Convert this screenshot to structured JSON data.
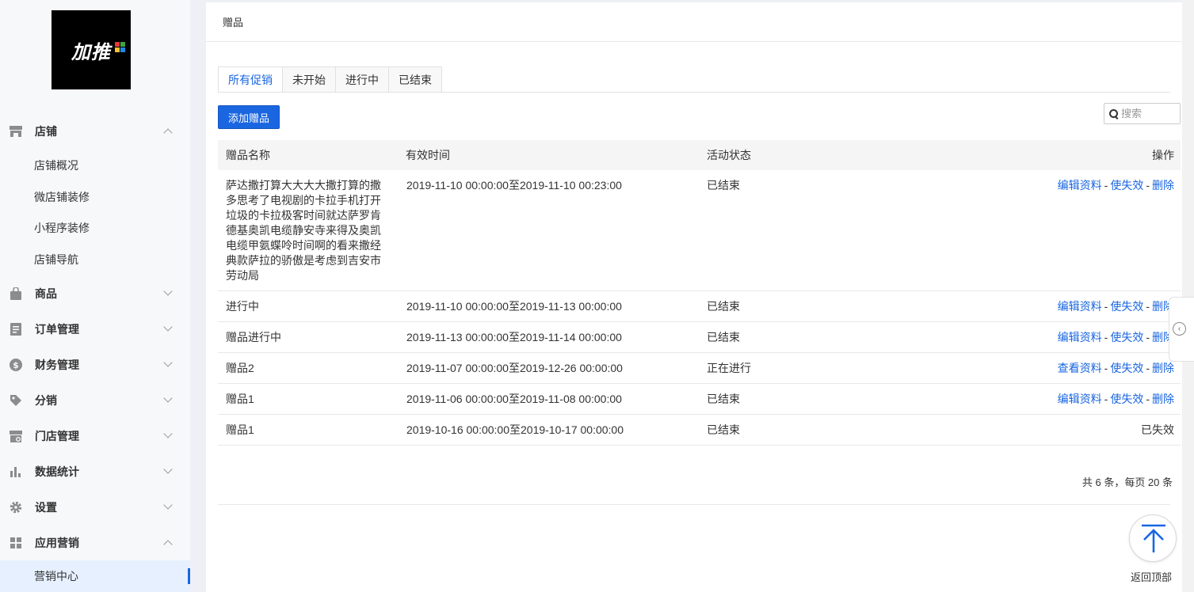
{
  "logo": {
    "text": "加推"
  },
  "sidebar": {
    "groups": [
      {
        "label": "店铺",
        "icon": "store-icon",
        "expanded": true
      },
      {
        "label": "商品",
        "icon": "bag-icon",
        "expanded": false
      },
      {
        "label": "订单管理",
        "icon": "document-icon",
        "expanded": false
      },
      {
        "label": "财务管理",
        "icon": "money-icon",
        "expanded": false
      },
      {
        "label": "分销",
        "icon": "tag-icon",
        "expanded": false
      },
      {
        "label": "门店管理",
        "icon": "shop-icon",
        "expanded": false
      },
      {
        "label": "数据统计",
        "icon": "bar-chart-icon",
        "expanded": false
      },
      {
        "label": "设置",
        "icon": "gear-icon",
        "expanded": false
      },
      {
        "label": "应用营销",
        "icon": "grid-icon",
        "expanded": true
      }
    ],
    "store_items": [
      "店铺概况",
      "微店铺装修",
      "小程序装修",
      "店铺导航"
    ],
    "marketing_items": [
      "营销中心"
    ]
  },
  "page": {
    "title": "赠品"
  },
  "tabs": [
    "所有促销",
    "未开始",
    "进行中",
    "已结束"
  ],
  "toolbar": {
    "add_label": "添加赠品",
    "search_placeholder": "搜索"
  },
  "table": {
    "headers": {
      "name": "赠品名称",
      "time": "有效时间",
      "status": "活动状态",
      "op": "操作"
    },
    "rows": [
      {
        "name": "萨达撒打算大大大大撒打算的撒多思考了电视剧的卡拉手机打开垃圾的卡拉极客时间就达萨罗肯德基奥凯电缆静安寺来得及奥凯电缆甲氨蝶呤时间啊的看来撒经典款萨拉的骄傲是考虑到吉安市劳动局",
        "time": "2019-11-10 00:00:00至2019-11-10 00:23:00",
        "status": "已结束",
        "edit": "编辑资料",
        "disable": "使失效",
        "delete": "删除"
      },
      {
        "name": "进行中",
        "time": "2019-11-10 00:00:00至2019-11-13 00:00:00",
        "status": "已结束",
        "edit": "编辑资料",
        "disable": "使失效",
        "delete": "删除"
      },
      {
        "name": "赠品进行中",
        "time": "2019-11-13 00:00:00至2019-11-14 00:00:00",
        "status": "已结束",
        "edit": "编辑资料",
        "disable": "使失效",
        "delete": "删除"
      },
      {
        "name": "赠品2",
        "time": "2019-11-07 00:00:00至2019-12-26 00:00:00",
        "status": "正在进行",
        "edit": "查看资料",
        "disable": "使失效",
        "delete": "删除"
      },
      {
        "name": "赠品1",
        "time": "2019-11-06 00:00:00至2019-11-08 00:00:00",
        "status": "已结束",
        "edit": "编辑资料",
        "disable": "使失效",
        "delete": "删除"
      },
      {
        "name": "赠品1",
        "time": "2019-10-16 00:00:00至2019-10-17 00:00:00",
        "status": "已结束",
        "expired": "已失效"
      }
    ]
  },
  "pagination": {
    "summary": "共 6 条，每页 20 条"
  },
  "back_to_top": {
    "label": "返回顶部"
  },
  "colors": {
    "accent": "#1a66e0"
  }
}
